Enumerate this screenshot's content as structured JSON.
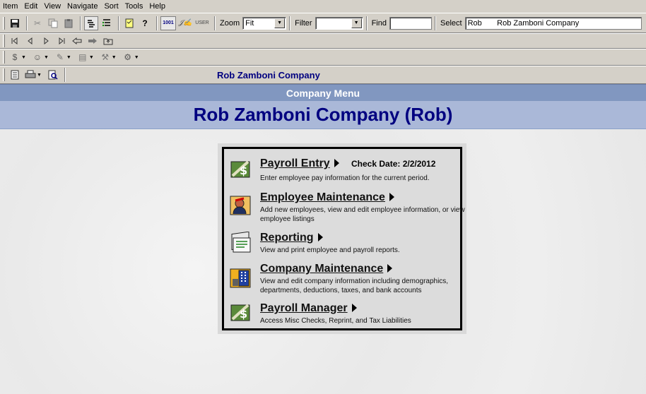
{
  "menubar": [
    "Item",
    "Edit",
    "View",
    "Navigate",
    "Sort",
    "Tools",
    "Help"
  ],
  "toolbar": {
    "zoom_label": "Zoom",
    "zoom_value": "Fit",
    "filter_label": "Filter",
    "filter_value": "",
    "find_label": "Find",
    "find_value": "",
    "select_label": "Select",
    "select_value": "Rob       Rob Zamboni Company",
    "btn_1001": "1001",
    "btn_user": "USER",
    "company_name": "Rob Zamboni Company"
  },
  "icons": {
    "save": "floppy-icon",
    "cut": "scissors-icon",
    "copy": "copy-icon",
    "paste": "paste-icon",
    "first": "first-record-icon",
    "prev": "previous-record-icon",
    "next": "next-record-icon",
    "last": "last-record-icon",
    "back": "back-arrow-icon",
    "forward": "forward-arrow-icon",
    "folder": "up-folder-icon"
  },
  "header": {
    "menu_title": "Company Menu",
    "company_title": "Rob Zamboni Company (Rob)"
  },
  "menu": {
    "items": [
      {
        "title": "Payroll Entry",
        "description": "Enter employee pay information for the current period.",
        "extra": "Check Date: 2/2/2012"
      },
      {
        "title": "Employee Maintenance",
        "description": "Add new employees, view and edit employee information, or view employee listings"
      },
      {
        "title": "Reporting",
        "description": "View and print employee and payroll reports."
      },
      {
        "title": "Company Maintenance",
        "description": "View and edit company information including demographics, departments, deductions, taxes, and bank accounts"
      },
      {
        "title": "Payroll Manager",
        "description": "Access Misc Checks, Reprint, and Tax Liabilities"
      }
    ]
  },
  "colors": {
    "menu_strip": "#8197c0",
    "company_band": "#aab8d8",
    "title_blue": "#000080"
  }
}
